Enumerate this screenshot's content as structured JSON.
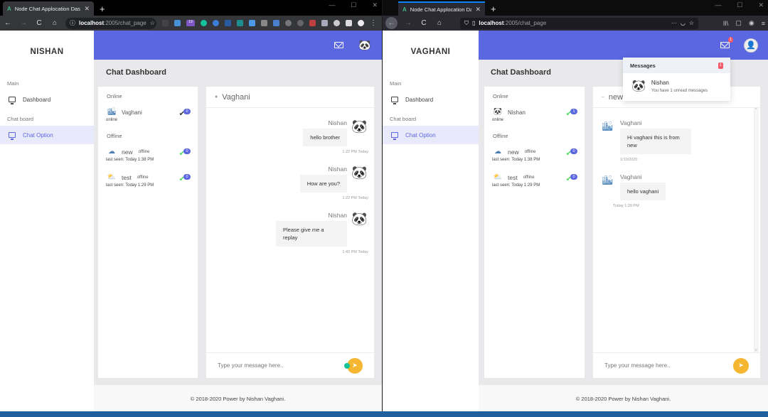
{
  "left_window": {
    "tab": {
      "favicon": "A",
      "title": "Node Chat Applocation Dashboa",
      "close": "✕"
    },
    "new_tab": "+",
    "window_controls": [
      "—",
      "☐",
      "✕"
    ],
    "nav": {
      "back": "←",
      "forward": "→",
      "reload": "C",
      "home": "⌂"
    },
    "url": {
      "info": "ⓘ",
      "host": "localhost",
      "path": ":2005/chat_page",
      "star": "☆"
    },
    "extension_badge": "19",
    "menu": "⋮",
    "app": {
      "brand": "NISHAN",
      "sidebar": {
        "sections": [
          {
            "label": "Main",
            "items": [
              {
                "label": "Dashboard",
                "active": false
              }
            ]
          },
          {
            "label": "Chat board",
            "items": [
              {
                "label": "Chat Option",
                "active": true
              }
            ]
          }
        ]
      },
      "topbar": {
        "mail_icon": "mail-icon",
        "avatar": "🐼"
      },
      "page_title": "Chat Dashboard",
      "users": {
        "online_label": "Online",
        "online": [
          {
            "name": "Vaghani",
            "status": "online",
            "count": "0",
            "avatar": "🏙"
          }
        ],
        "offline_label": "Offline",
        "offline": [
          {
            "name": "new",
            "status": "offline",
            "last_seen": "last seen: Today 1:38 PM",
            "count": "0",
            "avatar": "☁"
          },
          {
            "name": "test",
            "status": "offline",
            "last_seen": "last seen: Today 1:29 PM",
            "count": "0",
            "avatar": "⛅"
          }
        ]
      },
      "chat": {
        "header_name": "Vaghani",
        "messages": [
          {
            "sender": "Nishan",
            "text": "hello brother",
            "time": "1:22 PM Today",
            "avatar": "🐼"
          },
          {
            "sender": "Nishan",
            "text": "How are you?",
            "time": "1:22 PM Today",
            "avatar": "🐼"
          },
          {
            "sender": "Nishan",
            "text": "Please give me a replay",
            "time": "1:43 PM Today",
            "avatar": "🐼"
          }
        ],
        "input_placeholder": "Type your message here..",
        "send_icon": "➤"
      },
      "footer": "© 2018-2020 Power by Nishan Vaghani."
    }
  },
  "right_window": {
    "tab": {
      "favicon": "A",
      "title": "Node Chat Applocation Dashb",
      "close": "✕"
    },
    "new_tab": "+",
    "window_controls": [
      "—",
      "☐",
      "✕"
    ],
    "nav": {
      "back": "←",
      "forward": "→",
      "reload": "C",
      "home": "⌂"
    },
    "url": {
      "host": "localhost",
      "path": ":2005/chat_page",
      "more": "···",
      "star": "☆"
    },
    "toolbar_right": [
      "II\\",
      "▢",
      "◉",
      "≡"
    ],
    "app": {
      "brand": "VAGHANI",
      "sidebar": {
        "sections": [
          {
            "label": "Main",
            "items": [
              {
                "label": "Dashboard",
                "active": false
              }
            ]
          },
          {
            "label": "Chat board",
            "items": [
              {
                "label": "Chat Option",
                "active": true
              }
            ]
          }
        ]
      },
      "topbar": {
        "mail_badge": "1",
        "avatar": "👤"
      },
      "page_title": "Chat Dashboard",
      "users": {
        "online_label": "Online",
        "online": [
          {
            "name": "Nishan",
            "status": "online",
            "count": "1",
            "avatar": "🐼"
          }
        ],
        "offline_label": "Offline",
        "offline": [
          {
            "name": "new",
            "status": "offline",
            "last_seen": "last seen: Today 1:38 PM",
            "count": "0",
            "avatar": "☁"
          },
          {
            "name": "test",
            "status": "offline",
            "last_seen": "last seen: Today 1:29 PM",
            "count": "0",
            "avatar": "⛅"
          }
        ]
      },
      "chat": {
        "header_name": "new",
        "messages": [
          {
            "sender": "Vaghani",
            "text": "Hi vaghani this is from new",
            "time": "1/10/2020",
            "avatar": "🏙"
          },
          {
            "sender": "Vaghani",
            "text": "hello vaghani",
            "time": "Today 1:28 PM",
            "avatar": "🏙"
          }
        ],
        "input_placeholder": "Type your message here..",
        "send_icon": "➤"
      },
      "messages_dropdown": {
        "title": "Messages",
        "count": "1",
        "items": [
          {
            "name": "Nishan",
            "text": "You have 1 unread messages",
            "avatar": "🐼"
          }
        ]
      },
      "footer": "© 2018-2020 Power by Nishan Vaghani."
    }
  },
  "colors": {
    "primary": "#5b67e0",
    "send_button": "#f5b731",
    "badge_red": "#f25a6a",
    "check_green": "#4cd964"
  }
}
